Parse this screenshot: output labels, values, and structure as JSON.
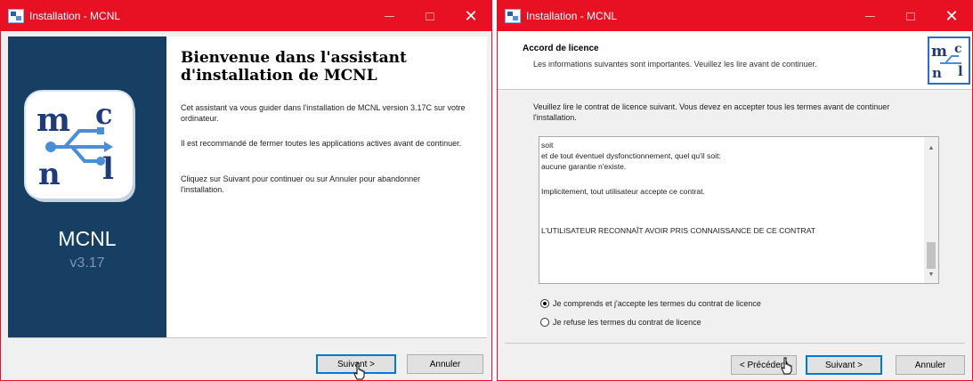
{
  "window1": {
    "title": "Installation - MCNL",
    "sidebar": {
      "name": "MCNL",
      "version": "v3.17"
    },
    "welcome_title": "Bienvenue dans l'assistant d'installation de MCNL",
    "paragraphs": [
      "Cet assistant va vous guider dans l'installation de MCNL version 3.17C sur votre ordinateur.",
      "Il est recommandé de fermer toutes les applications actives avant de continuer.",
      "Cliquez sur Suivant pour continuer ou sur Annuler pour abandonner l'installation."
    ],
    "buttons": {
      "next": "Suivant >",
      "cancel": "Annuler"
    }
  },
  "window2": {
    "title": "Installation - MCNL",
    "header_title": "Accord de licence",
    "header_subtitle": "Les informations suivantes sont importantes. Veuillez les lire avant de continuer.",
    "instruction": "Veuillez lire le contrat de licence suivant. Vous devez en accepter tous les termes avant de continuer l'installation.",
    "license_lines": [
      "soit",
      "et de tout éventuel dysfonctionnement, quel qu'il soit:",
      "aucune garantie n'existe.",
      "Implicitement, tout utilisateur accepte ce contrat.",
      "L'UTILISATEUR RECONNAÎT AVOIR PRIS CONNAISSANCE DE CE CONTRAT"
    ],
    "radio_accept": "Je comprends et j'accepte les termes du contrat de licence",
    "radio_refuse": "Je refuse les termes du contrat de licence",
    "accept_selected": true,
    "buttons": {
      "prev": "< Précédent",
      "next": "Suivant >",
      "cancel": "Annuler"
    }
  },
  "colors": {
    "titlebar": "#e81123",
    "sidebar": "#173f63",
    "accent": "#0078d7"
  }
}
